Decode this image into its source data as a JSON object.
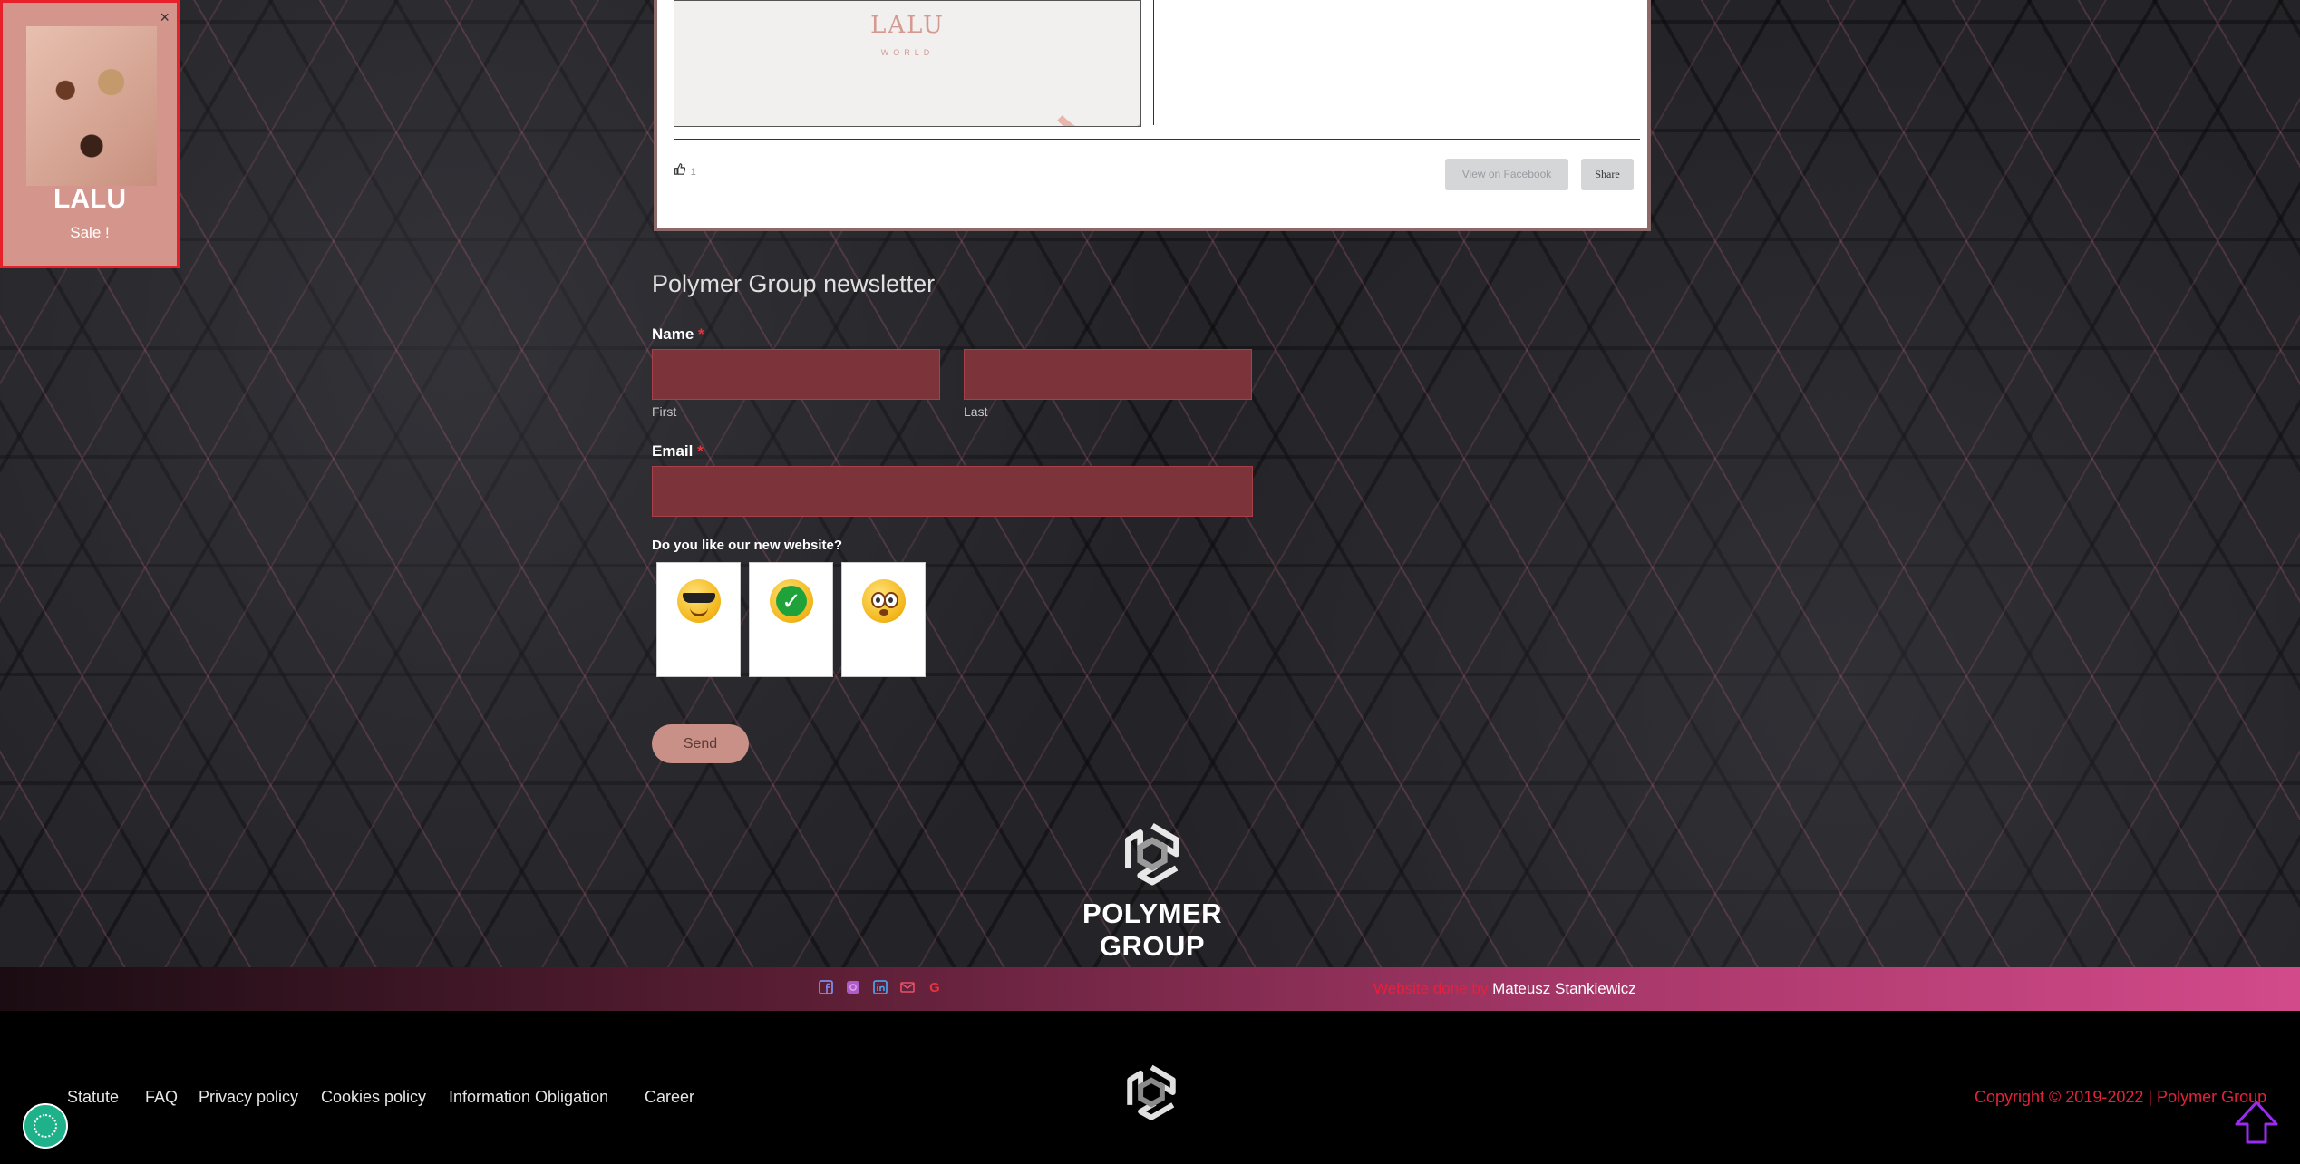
{
  "promo": {
    "brand": "LALU",
    "tagline": "Sale !",
    "close": "×"
  },
  "facebook_post": {
    "image_brand": "LALU",
    "image_sub": "WORLD",
    "like_count": "1",
    "view_label": "View on Facebook",
    "share_label": "Share"
  },
  "newsletter": {
    "title": "Polymer Group newsletter",
    "name_label": "Name",
    "required_mark": "*",
    "first_value": "",
    "last_value": "",
    "first_sublabel": "First",
    "last_sublabel": "Last",
    "email_label": "Email",
    "email_value": "",
    "question": "Do you like our new website?",
    "choices": [
      "sunglasses-face",
      "check-mark",
      "flushed-face"
    ],
    "send_label": "Send"
  },
  "brand": {
    "name": "POLYMER GROUP"
  },
  "bar": {
    "social_icons": [
      "facebook-icon",
      "instagram-icon",
      "linkedin-icon",
      "email-icon",
      "google-icon"
    ],
    "credit_prefix": "Website done by",
    "credit_name": "Mateusz Stankiewicz"
  },
  "footer": {
    "links": [
      "Statute",
      "FAQ",
      "Privacy policy",
      "Cookies policy",
      "Information Obligation",
      "Career"
    ],
    "copyright": "Copyright © 2019-2022 | Polymer Group"
  },
  "colors": {
    "accent_pink": "#d24a8a",
    "field_bg": "#7c343a",
    "required": "#e8323c",
    "send_bg": "#c99087"
  }
}
